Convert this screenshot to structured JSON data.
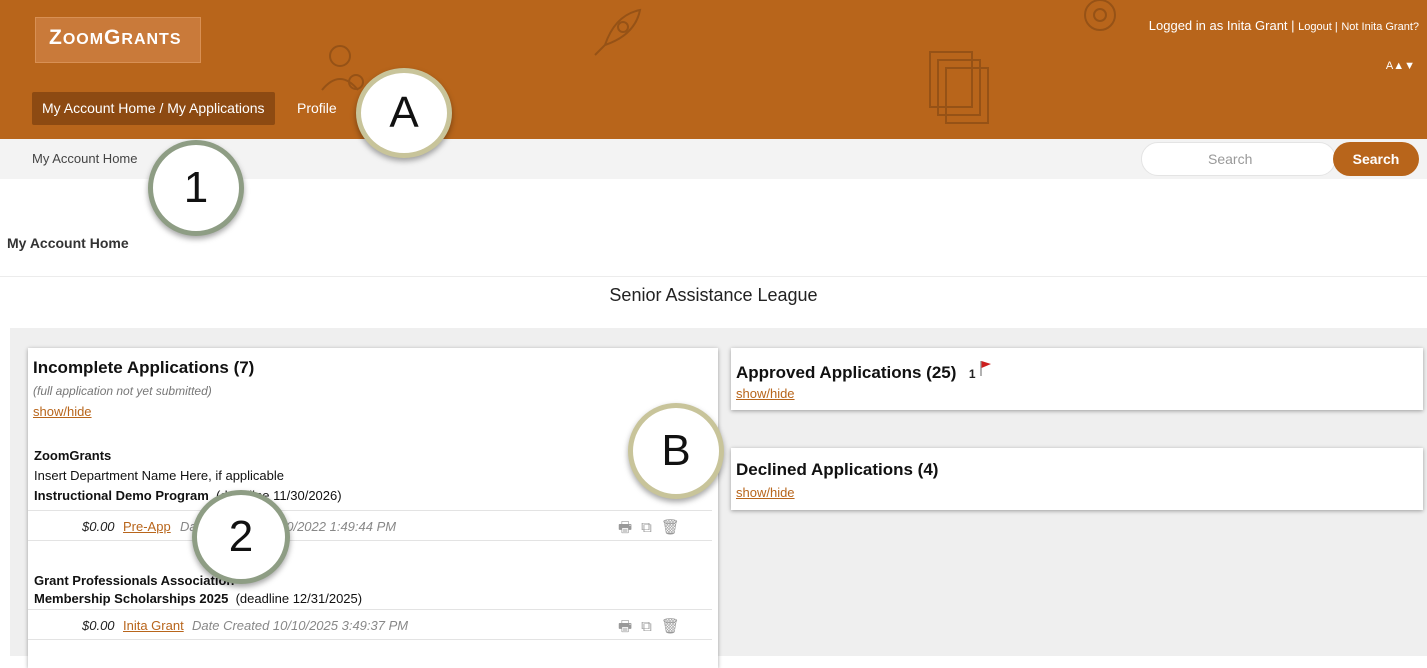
{
  "header": {
    "logo": {
      "z": "Z",
      "oom": "OOM",
      "g": "G",
      "rants": "RANTS"
    },
    "nav": {
      "home_label": "My Account Home / My Applications",
      "profile_label": "Profile"
    },
    "login": {
      "logged_in_text": "Logged in as Inita Grant |",
      "logout_label": "Logout |",
      "not_user_label": "Not Inita Grant?"
    },
    "font_size_ctrl": "A▲▼"
  },
  "subbar": {
    "breadcrumb": "My Account Home",
    "search_placeholder": "Search",
    "search_button": "Search"
  },
  "page": {
    "heading": "My Account Home",
    "org_name": "Senior Assistance League"
  },
  "incomplete": {
    "title": "Incomplete Applications (7)",
    "note": "(full application not yet submitted)",
    "showhide": "show/hide",
    "apps": [
      {
        "org": "ZoomGrants",
        "dept": "Insert Department Name Here, if applicable",
        "program": "Instructional Demo Program",
        "deadline": "(deadline 11/30/2026)",
        "amount": "$0.00",
        "link": "Pre-App",
        "created": "Date Created 10/10/2022 1:49:44 PM"
      },
      {
        "org": "Grant Professionals Association",
        "program": "Membership Scholarships 2025",
        "deadline": "(deadline 12/31/2025)",
        "amount": "$0.00",
        "link": "Inita Grant",
        "created": "Date Created 10/10/2025 3:49:37 PM"
      }
    ]
  },
  "approved": {
    "title": "Approved Applications (25)",
    "flag_count": "1",
    "showhide": "show/hide"
  },
  "declined": {
    "title": "Declined Applications (4)",
    "showhide": "show/hide"
  },
  "callouts": {
    "a": "A",
    "b": "B",
    "one": "1",
    "two": "2"
  },
  "icons": {
    "print": "printer-icon",
    "copy": "copy-icon",
    "delete": "trash-icon",
    "flag": "flag-icon"
  },
  "colors": {
    "brand": "#b8651b",
    "nav_active": "#8d4a12",
    "link": "#b8651b",
    "flag": "#cc1f1f"
  }
}
